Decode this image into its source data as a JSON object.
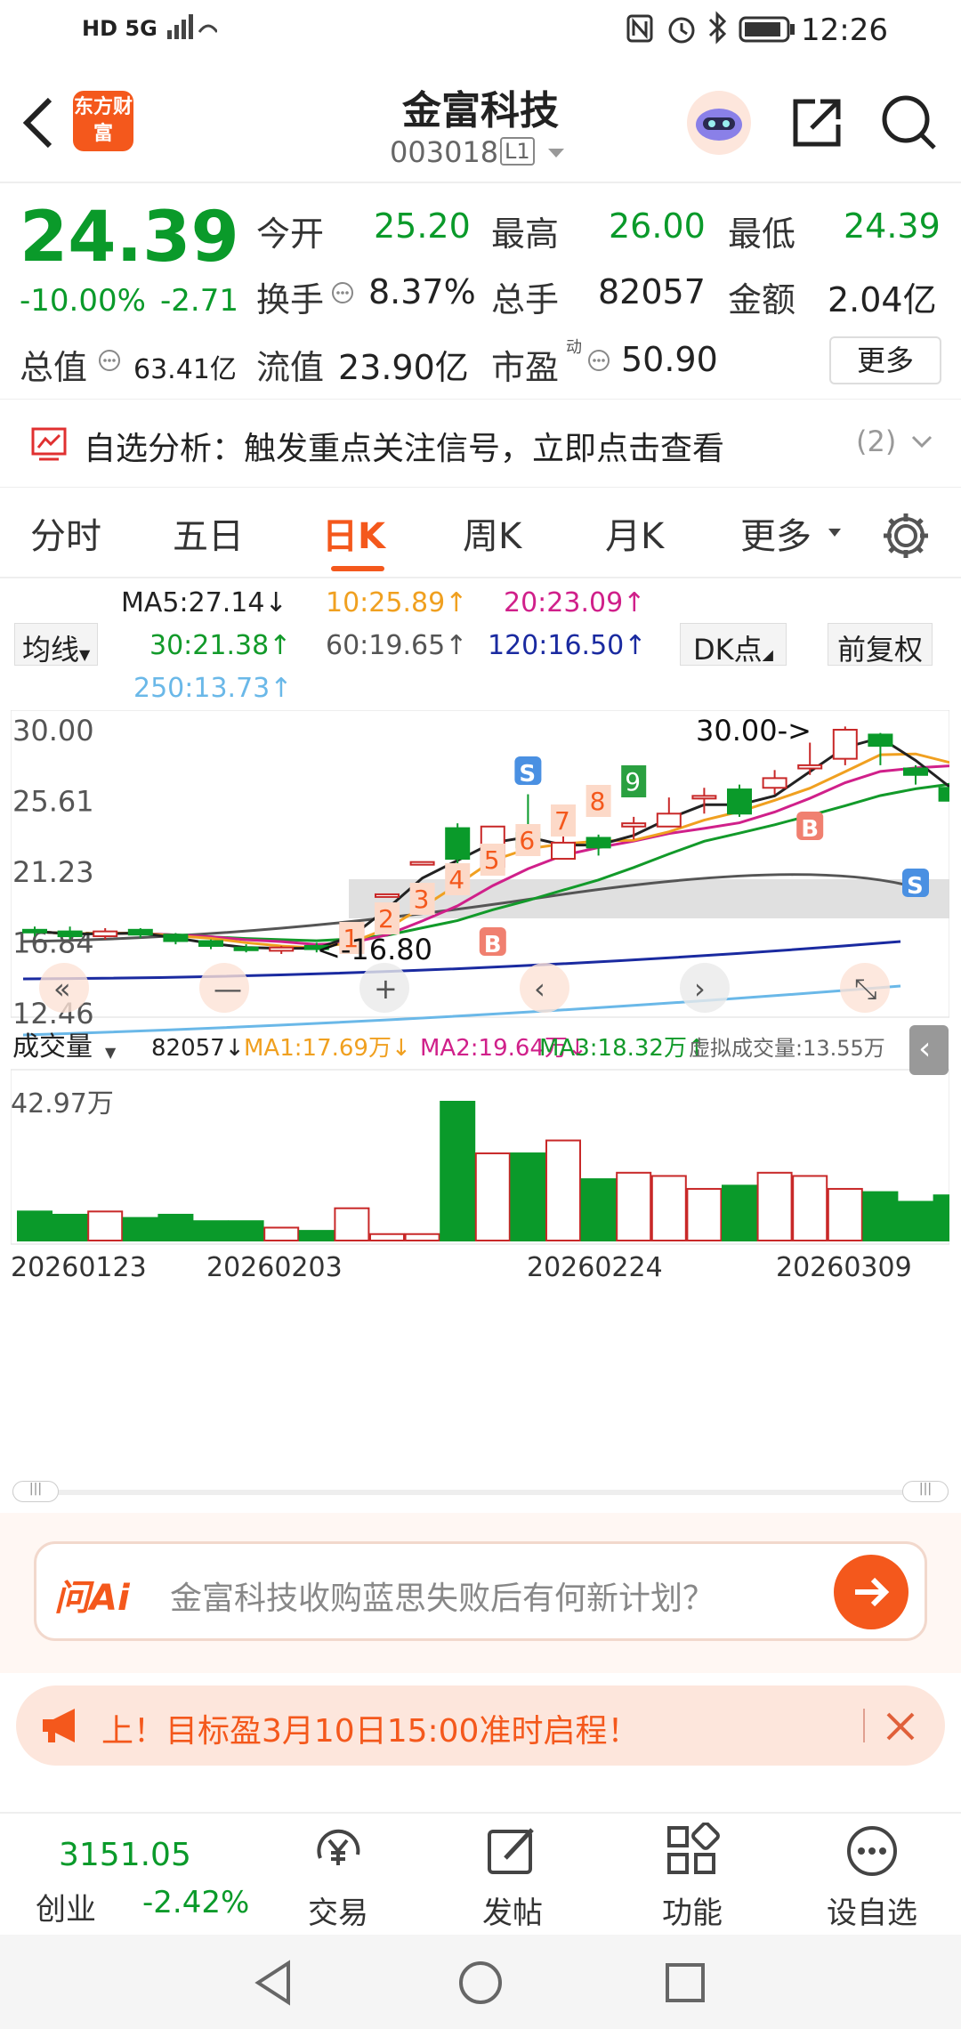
{
  "status": {
    "time": "12:26",
    "left_icons": "HD 5G"
  },
  "header": {
    "title": "金富科技",
    "code": "003018",
    "level": "L1",
    "logo_text": "东方财富"
  },
  "quote": {
    "price": "24.39",
    "change_pct": "-10.00%",
    "change": "-2.71",
    "total_value_label": "总值",
    "total_value": "63.41亿",
    "open_label": "今开",
    "open": "25.20",
    "high_label": "最高",
    "high": "26.00",
    "low_label": "最低",
    "low": "24.39",
    "turnover_label": "换手",
    "turnover": "8.37%",
    "volume_label": "总手",
    "volume": "82057",
    "amount_label": "金额",
    "amount": "2.04亿",
    "float_label": "流值",
    "float_value": "23.90亿",
    "pe_label": "市盈",
    "pe_sup": "动",
    "pe": "50.90",
    "more_btn": "更多"
  },
  "banner": {
    "text": "自选分析：触发重点关注信号，立即点击查看",
    "count": "(2)"
  },
  "tabs": [
    "分时",
    "五日",
    "日K",
    "周K",
    "月K",
    "更多"
  ],
  "ma": {
    "ma5": "MA5:27.14↓",
    "ma10": "10:25.89↑",
    "ma20": "20:23.09↑",
    "ma30": "30:21.38↑",
    "ma60": "60:19.65↑",
    "ma120": "120:16.50↑",
    "ma250": "250:13.73↑",
    "ma_btn": "均线",
    "dk_btn": "DK点",
    "adj_btn": "前复权",
    "colors": {
      "ma5": "#222222",
      "ma10": "#f0a020",
      "ma20": "#d0208a",
      "ma30": "#129a2a",
      "ma60": "#555555",
      "ma120": "#1a2aa0",
      "ma250": "#6ab8e8"
    }
  },
  "chart_data": {
    "type": "candlestick",
    "y_labels": [
      "30.00",
      "25.61",
      "21.23",
      "16.84",
      "12.46"
    ],
    "ylim": [
      12.46,
      30.0
    ],
    "annotations": {
      "high": "30.00->",
      "low": "<-16.80"
    },
    "counter_labels": [
      "1",
      "2",
      "3",
      "4",
      "5",
      "6",
      "7",
      "8",
      "9"
    ],
    "signals": [
      "S",
      "B",
      "B",
      "S"
    ],
    "candles": [
      {
        "o": 17.6,
        "c": 17.5,
        "h": 17.8,
        "l": 17.2
      },
      {
        "o": 17.5,
        "c": 17.2,
        "h": 17.8,
        "l": 17.0
      },
      {
        "o": 17.2,
        "c": 17.5,
        "h": 17.7,
        "l": 17.0
      },
      {
        "o": 17.6,
        "c": 17.3,
        "h": 17.7,
        "l": 17.1
      },
      {
        "o": 17.3,
        "c": 16.9,
        "h": 17.4,
        "l": 16.7
      },
      {
        "o": 16.9,
        "c": 16.6,
        "h": 17.0,
        "l": 16.4
      },
      {
        "o": 16.5,
        "c": 16.4,
        "h": 16.7,
        "l": 16.2
      },
      {
        "o": 16.3,
        "c": 16.5,
        "h": 16.6,
        "l": 16.1
      },
      {
        "o": 16.6,
        "c": 16.4,
        "h": 16.8,
        "l": 16.2
      },
      {
        "o": 16.4,
        "c": 18.0,
        "h": 18.0,
        "l": 16.2
      },
      {
        "o": 19.8,
        "c": 19.8,
        "h": 19.8,
        "l": 19.8
      },
      {
        "o": 21.8,
        "c": 21.8,
        "h": 21.8,
        "l": 21.8
      },
      {
        "o": 23.9,
        "c": 22.0,
        "h": 24.2,
        "l": 21.6
      },
      {
        "o": 21.5,
        "c": 24.0,
        "h": 24.0,
        "l": 21.2
      },
      {
        "o": 23.6,
        "c": 22.7,
        "h": 26.0,
        "l": 22.6
      },
      {
        "o": 22.0,
        "c": 23.0,
        "h": 24.5,
        "l": 22.0
      },
      {
        "o": 23.3,
        "c": 22.7,
        "h": 23.5,
        "l": 22.2
      },
      {
        "o": 24.0,
        "c": 24.2,
        "h": 24.6,
        "l": 23.2
      },
      {
        "o": 24.0,
        "c": 24.8,
        "h": 25.8,
        "l": 24.0
      },
      {
        "o": 25.9,
        "c": 25.9,
        "h": 26.4,
        "l": 24.8
      },
      {
        "o": 26.3,
        "c": 24.8,
        "h": 26.6,
        "l": 24.6
      },
      {
        "o": 26.4,
        "c": 27.0,
        "h": 27.5,
        "l": 26.0
      },
      {
        "o": 27.6,
        "c": 27.8,
        "h": 29.2,
        "l": 27.2
      },
      {
        "o": 28.2,
        "c": 30.0,
        "h": 30.2,
        "l": 27.8
      },
      {
        "o": 29.7,
        "c": 29.0,
        "h": 29.8,
        "l": 27.8
      },
      {
        "o": 27.6,
        "c": 27.2,
        "h": 27.8,
        "l": 26.6
      },
      {
        "o": 26.4,
        "c": 25.6,
        "h": 27.0,
        "l": 25.4
      }
    ],
    "volume": {
      "label": "成交量",
      "value": "82057↓",
      "ma1": "MA1:17.69万↓",
      "ma2": "MA2:19.64万↓",
      "ma3": "MA3:18.32万↑",
      "virtual": "虚拟成交量:13.55万",
      "max_label": "42.97万",
      "dates": [
        "20260123",
        "20260203",
        "20260224",
        "20260309"
      ],
      "bars": [
        9,
        8,
        9,
        7,
        8,
        6,
        6,
        4,
        3,
        10,
        2,
        2,
        43,
        27,
        27,
        31,
        19,
        21,
        20,
        16,
        17,
        21,
        20,
        16,
        15,
        12,
        14
      ],
      "up": [
        false,
        false,
        true,
        false,
        false,
        false,
        false,
        true,
        false,
        true,
        true,
        true,
        false,
        true,
        false,
        true,
        false,
        true,
        true,
        true,
        false,
        true,
        true,
        true,
        false,
        false,
        false
      ]
    }
  },
  "ai": {
    "logo": "问Ai",
    "placeholder": "金富科技收购蓝思失败后有何新计划？"
  },
  "promo": {
    "text": "上！目标盈3月10日15:00准时启程！"
  },
  "bottom": {
    "index_value": "3151.05",
    "index_name": "创业",
    "index_change": "-2.42%",
    "trade": "交易",
    "post": "发帖",
    "func": "功能",
    "watch": "设自选"
  }
}
